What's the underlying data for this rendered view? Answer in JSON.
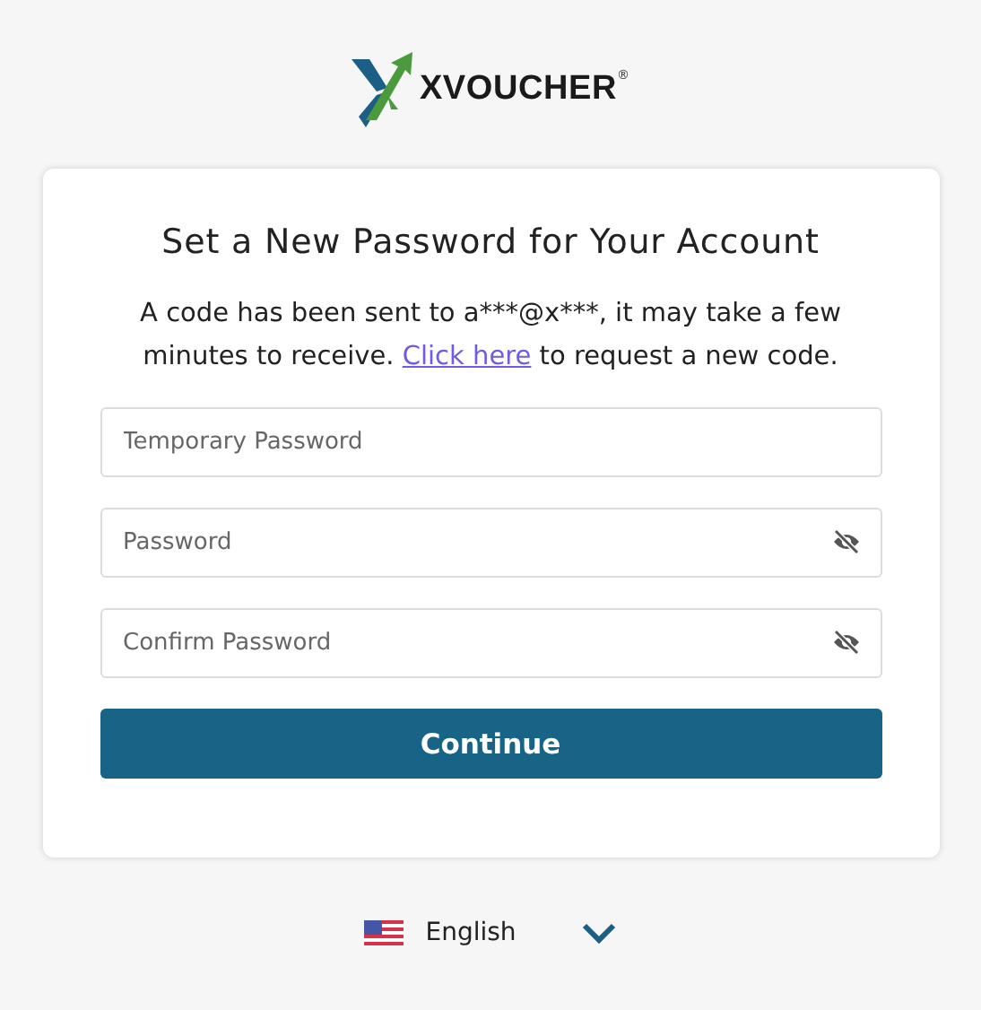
{
  "logo": {
    "text": "XVOUCHER",
    "mark": "®"
  },
  "card": {
    "title": "Set a New Password for Your Account",
    "message_before": "A code has been sent to a***@x***, it may take a few minutes to receive.",
    "link": "Click here",
    "message_after": "to request a new code.",
    "fields": [
      {
        "placeholder": "Temporary Password",
        "kind": "text"
      },
      {
        "placeholder": "Password",
        "kind": "password"
      },
      {
        "placeholder": "Confirm Password",
        "kind": "password"
      }
    ],
    "button": "Continue"
  },
  "language": {
    "label": "English"
  }
}
